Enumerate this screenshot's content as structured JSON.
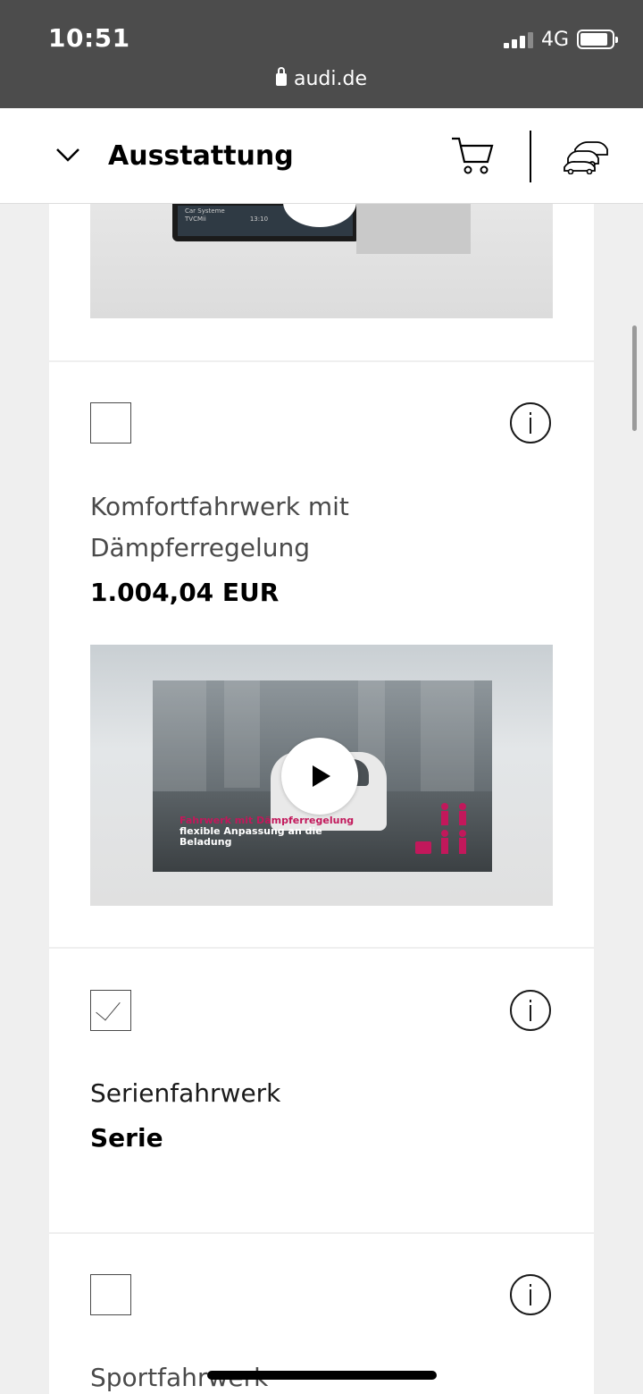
{
  "status_bar": {
    "time": "10:51",
    "network": "4G",
    "url": "audi.de"
  },
  "header": {
    "title": "Ausstattung"
  },
  "preview": {
    "screen_text_1": "Car Systeme",
    "screen_text_2": "TVCMii",
    "screen_text_3": "13:10"
  },
  "options": [
    {
      "title": "Komfortfahrwerk mit Dämpferregelung",
      "price": "1.004,04 EUR",
      "checked": false
    },
    {
      "title": "Serienfahrwerk",
      "price": "Serie",
      "checked": true
    },
    {
      "title": "Sportfahrwerk",
      "checked": false
    }
  ],
  "video": {
    "caption_highlight": "Fahrwerk mit Dämpferregelung",
    "caption_text": "flexible Anpassung an die Beladung"
  },
  "colors": {
    "statusbar_bg": "#4c4c4c",
    "highlight": "#c2185b"
  }
}
